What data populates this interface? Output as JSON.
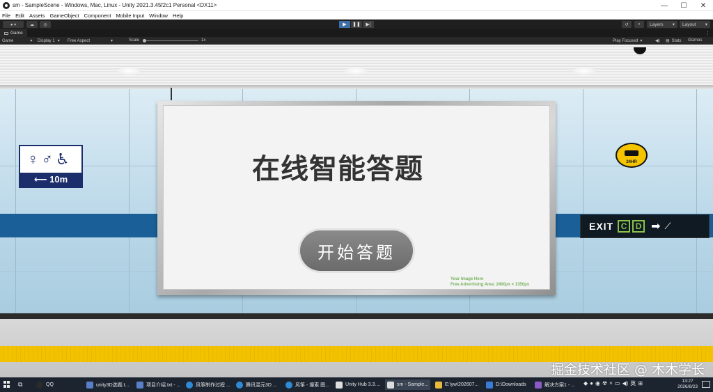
{
  "window": {
    "title": "sm - SampleScene - Windows, Mac, Linux - Unity 2021.3.45f2c1 Personal <DX11>",
    "minimize": "—",
    "maximize": "☐",
    "close": "✕"
  },
  "menu": [
    "File",
    "Edit",
    "Assets",
    "GameObject",
    "Component",
    "Mobile Input",
    "Window",
    "Help"
  ],
  "toolbar": {
    "layers_label": "Layers",
    "layout_label": "Layout"
  },
  "game_tab": {
    "label": "Game"
  },
  "game_bar": {
    "view_mode": "Game",
    "display": "Display 1",
    "aspect": "Free Aspect",
    "scale_label": "Scale",
    "scale_value": "1x",
    "play_focused": "Play Focused",
    "stats": "Stats",
    "gizmos": "Gizmos"
  },
  "scene": {
    "billboard_title": "在线智能答题",
    "start_button": "开始答题",
    "ad_line1": "Your Image Here",
    "ad_line2": "Free Advertising Area: 2400px × 1350px",
    "restroom_distance": "⟵ 10m",
    "cctv_label": "24HR",
    "exit_word": "EXIT",
    "exit_c": "C",
    "exit_d": "D"
  },
  "watermark": "掘金技术社区 @ 木木学长",
  "taskbar": {
    "tasks": [
      {
        "label": "QQ",
        "color": "#2b2b2b"
      },
      {
        "label": "unity3D选题.t...",
        "color": "#5b7fc7"
      },
      {
        "label": "项目介绍.txt - ...",
        "color": "#5b7fc7"
      },
      {
        "label": "风筝制作过程 ...",
        "color": "#2f8ad6"
      },
      {
        "label": "腾讯混元3D ...",
        "color": "#2f8ad6"
      },
      {
        "label": "风筝 - 搜索 图...",
        "color": "#2f8ad6"
      },
      {
        "label": "Unity Hub 3.3....",
        "color": "#dddddd"
      },
      {
        "label": "sm - Sample...",
        "color": "#dddddd"
      },
      {
        "label": "E:\\yw\\202607...",
        "color": "#e8b93a"
      },
      {
        "label": "D:\\Downloads",
        "color": "#3a7bd5"
      },
      {
        "label": "解决方案1 - ...",
        "color": "#8a5ac9"
      }
    ],
    "ime": "英",
    "time": "13:27",
    "date": "2026/8/23"
  }
}
